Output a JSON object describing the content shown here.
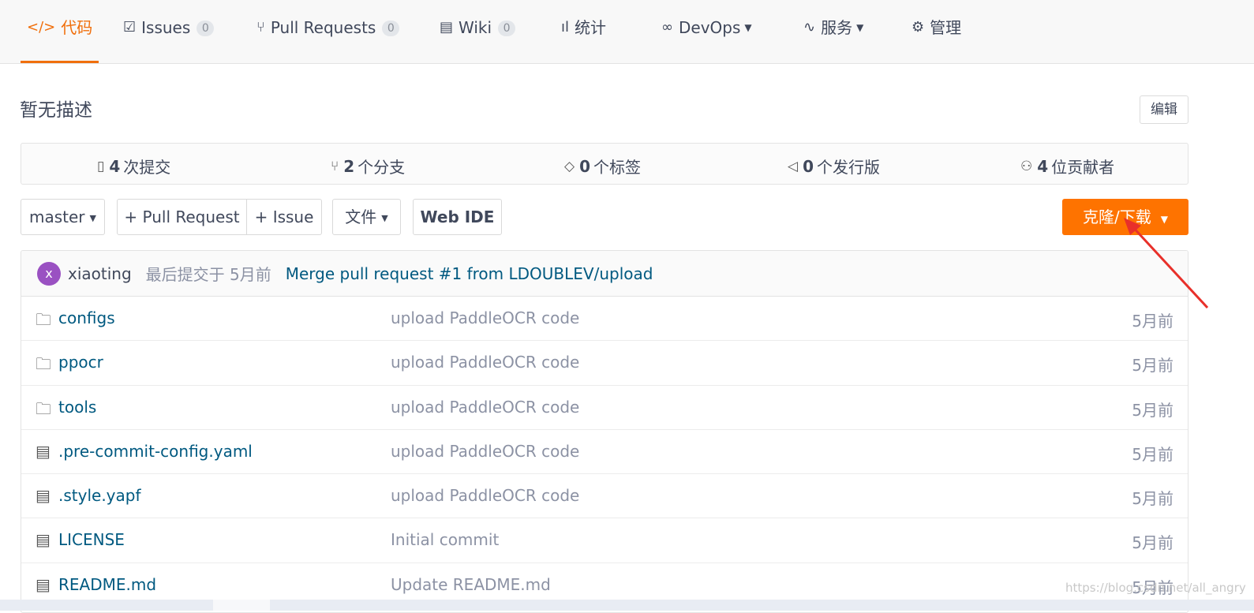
{
  "tabs": [
    {
      "label": "代码",
      "icon": "code-icon",
      "active": true
    },
    {
      "label": "Issues",
      "icon": "issues-icon",
      "count": "0"
    },
    {
      "label": "Pull Requests",
      "icon": "pull-request-icon",
      "count": "0"
    },
    {
      "label": "Wiki",
      "icon": "wiki-icon",
      "count": "0"
    },
    {
      "label": "统计",
      "icon": "chart-icon"
    },
    {
      "label": "DevOps",
      "icon": "infinity-icon",
      "dropdown": true
    },
    {
      "label": "服务",
      "icon": "pulse-icon",
      "dropdown": true
    },
    {
      "label": "管理",
      "icon": "manage-icon"
    }
  ],
  "repo": {
    "description": "暂无描述",
    "edit_label": "编辑"
  },
  "stats": [
    {
      "value": "4",
      "label": "次提交",
      "icon": "commit-icon"
    },
    {
      "value": "2",
      "label": "个分支",
      "icon": "branch-icon"
    },
    {
      "value": "0",
      "label": "个标签",
      "icon": "tag-icon"
    },
    {
      "value": "0",
      "label": "个发行版",
      "icon": "release-icon"
    },
    {
      "value": "4",
      "label": "位贡献者",
      "icon": "contributors-icon"
    }
  ],
  "toolbar": {
    "branch": "master",
    "pull_request": "+ Pull Request",
    "issue": "+ Issue",
    "file": "文件",
    "web_ide": "Web IDE",
    "clone": "克隆/下载"
  },
  "latest_commit": {
    "avatar_letter": "x",
    "author": "xiaoting",
    "time": "最后提交于 5月前",
    "message": "Merge pull request #1 from LDOUBLEV/upload"
  },
  "files": [
    {
      "name": "configs",
      "type": "folder",
      "message": "upload PaddleOCR code",
      "time": "5月前"
    },
    {
      "name": "ppocr",
      "type": "folder",
      "message": "upload PaddleOCR code",
      "time": "5月前"
    },
    {
      "name": "tools",
      "type": "folder",
      "message": "upload PaddleOCR code",
      "time": "5月前"
    },
    {
      "name": ".pre-commit-config.yaml",
      "type": "file",
      "message": "upload PaddleOCR code",
      "time": "5月前"
    },
    {
      "name": ".style.yapf",
      "type": "file",
      "message": "upload PaddleOCR code",
      "time": "5月前"
    },
    {
      "name": "LICENSE",
      "type": "file",
      "message": "Initial commit",
      "time": "5月前"
    },
    {
      "name": "README.md",
      "type": "file",
      "message": "Update README.md",
      "time": "5月前"
    }
  ],
  "watermark": "https://blog.csdn.net/all_angry",
  "colors": {
    "accent": "#f06f0c",
    "clone_button": "#fe7300",
    "link": "#005980",
    "avatar": "#9a51c2",
    "annotation_arrow": "#e8302a"
  }
}
